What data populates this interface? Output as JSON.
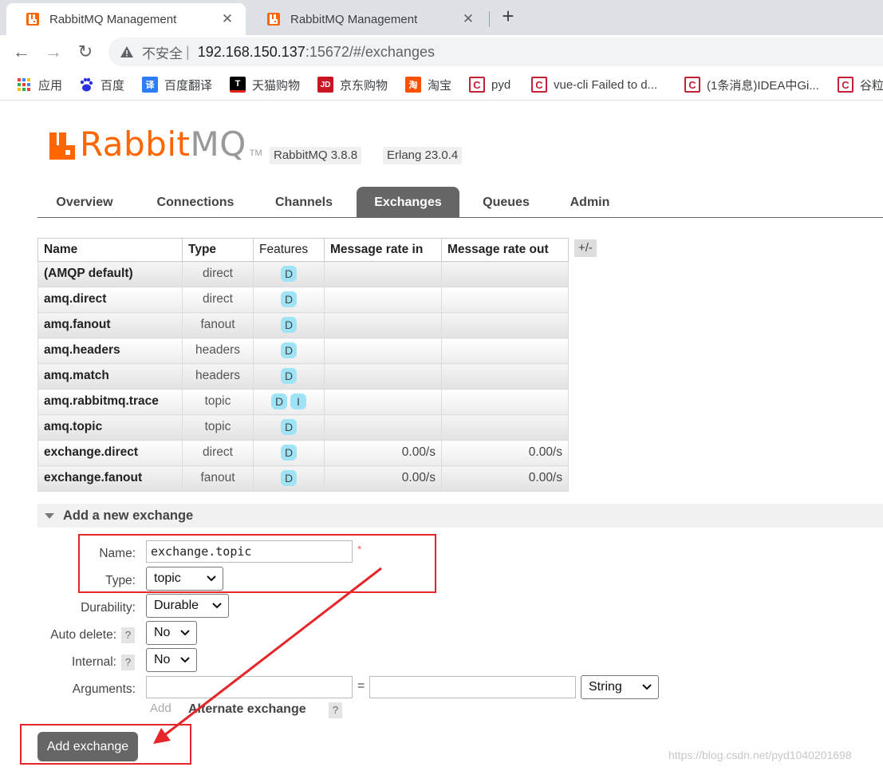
{
  "browser": {
    "tabs": [
      {
        "title": "RabbitMQ Management",
        "active": true
      },
      {
        "title": "RabbitMQ Management",
        "active": false
      }
    ],
    "close_glyph": "✕",
    "new_tab_glyph": "+",
    "back_glyph": "←",
    "forward_glyph": "→",
    "reload_glyph": "↻",
    "insecure_label": "不安全",
    "separator": "|",
    "url_host": "192.168.150.137",
    "url_rest": ":15672/#/exchanges",
    "bookmarks": [
      {
        "label": "应用",
        "icon": "apps-grid-icon",
        "color": "#ea4335"
      },
      {
        "label": "百度",
        "icon": "baidu-paw-icon",
        "color": "#2932e1"
      },
      {
        "label": "百度翻译",
        "icon": "baidu-translate-icon",
        "color": "#2e7cf6"
      },
      {
        "label": "天猫购物",
        "icon": "tmall-icon",
        "color": "#000000"
      },
      {
        "label": "京东购物",
        "icon": "jd-icon",
        "color": "#c91623"
      },
      {
        "label": "淘宝",
        "icon": "taobao-icon",
        "color": "#ff5000"
      },
      {
        "label": "pyd",
        "icon": "csdn-icon",
        "color": "#c32136"
      },
      {
        "label": "vue-cli Failed to d...",
        "icon": "csdn-icon",
        "color": "#c32136"
      },
      {
        "label": "(1条消息)IDEA中Gi...",
        "icon": "csdn-icon",
        "color": "#c32136"
      },
      {
        "label": "谷粒",
        "icon": "csdn-icon",
        "color": "#c32136"
      }
    ],
    "bookmark_glyphs": {
      "translate": "译",
      "tmall": "T",
      "jd": "JD",
      "taobao": "淘",
      "csdn": "C"
    }
  },
  "header": {
    "logo_rabbit": "Rabbit",
    "logo_mq": "MQ",
    "logo_tm": "TM",
    "version": "RabbitMQ 3.8.8",
    "erlang": "Erlang 23.0.4",
    "brand_color": "#ff6600"
  },
  "nav": {
    "tabs": [
      "Overview",
      "Connections",
      "Channels",
      "Exchanges",
      "Queues",
      "Admin"
    ],
    "active": "Exchanges"
  },
  "table": {
    "headers": [
      "Name",
      "Type",
      "Features",
      "Message rate in",
      "Message rate out"
    ],
    "toggle_label": "+/-",
    "rows": [
      {
        "name": "(AMQP default)",
        "type": "direct",
        "features": [
          "D"
        ],
        "rate_in": "",
        "rate_out": ""
      },
      {
        "name": "amq.direct",
        "type": "direct",
        "features": [
          "D"
        ],
        "rate_in": "",
        "rate_out": ""
      },
      {
        "name": "amq.fanout",
        "type": "fanout",
        "features": [
          "D"
        ],
        "rate_in": "",
        "rate_out": ""
      },
      {
        "name": "amq.headers",
        "type": "headers",
        "features": [
          "D"
        ],
        "rate_in": "",
        "rate_out": ""
      },
      {
        "name": "amq.match",
        "type": "headers",
        "features": [
          "D"
        ],
        "rate_in": "",
        "rate_out": ""
      },
      {
        "name": "amq.rabbitmq.trace",
        "type": "topic",
        "features": [
          "D",
          "I"
        ],
        "rate_in": "",
        "rate_out": ""
      },
      {
        "name": "amq.topic",
        "type": "topic",
        "features": [
          "D"
        ],
        "rate_in": "",
        "rate_out": ""
      },
      {
        "name": "exchange.direct",
        "type": "direct",
        "features": [
          "D"
        ],
        "rate_in": "0.00/s",
        "rate_out": "0.00/s"
      },
      {
        "name": "exchange.fanout",
        "type": "fanout",
        "features": [
          "D"
        ],
        "rate_in": "0.00/s",
        "rate_out": "0.00/s"
      }
    ],
    "badge_color": "#9ee3f6"
  },
  "form": {
    "section_title": "Add a new exchange",
    "name_label": "Name:",
    "name_value": "exchange.topic",
    "required_mark": "*",
    "type_label": "Type:",
    "type_value": "topic",
    "durability_label": "Durability:",
    "durability_value": "Durable",
    "auto_delete_label": "Auto delete:",
    "auto_delete_value": "No",
    "internal_label": "Internal:",
    "internal_value": "No",
    "arguments_label": "Arguments:",
    "arguments_key": "",
    "arguments_value": "",
    "arguments_equals": "=",
    "arguments_type": "String",
    "help_glyph": "?",
    "add_link": "Add",
    "alternate_exchange": "Alternate exchange",
    "submit_label": "Add exchange"
  },
  "annotation": {
    "highlight_color": "#e5262b",
    "watermark": "https://blog.csdn.net/pyd1040201698"
  }
}
